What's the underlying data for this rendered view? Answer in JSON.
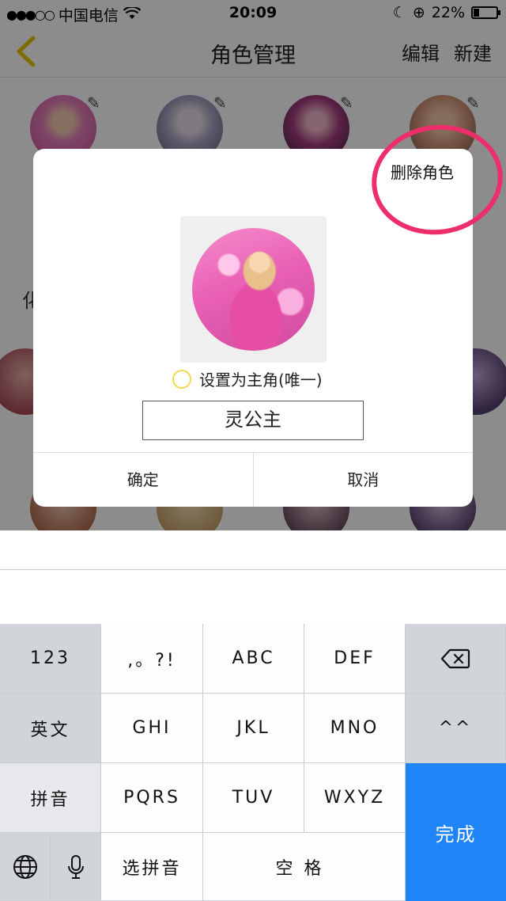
{
  "status_bar": {
    "carrier": "中国电信",
    "time": "20:09",
    "battery": "22%",
    "battery_level": 0.22
  },
  "nav": {
    "title": "角色管理",
    "edit_label": "编辑",
    "new_label": "新建"
  },
  "background_partial_text": "化",
  "dialog": {
    "delete_label": "删除角色",
    "main_role_label": "设置为主角(唯一)",
    "name_value": "灵公主",
    "confirm_label": "确定",
    "cancel_label": "取消"
  },
  "annotation_color": "#ee2d6b",
  "keyboard": {
    "row1": [
      "123",
      ",。?!",
      "ABC",
      "DEF"
    ],
    "row2": [
      "英文",
      "GHI",
      "JKL",
      "MNO",
      "^^"
    ],
    "row3": [
      "拼音",
      "PQRS",
      "TUV",
      "WXYZ"
    ],
    "row4": [
      "选拼音",
      "空格"
    ],
    "done_label": "完成",
    "accent": "#1f84f5"
  }
}
